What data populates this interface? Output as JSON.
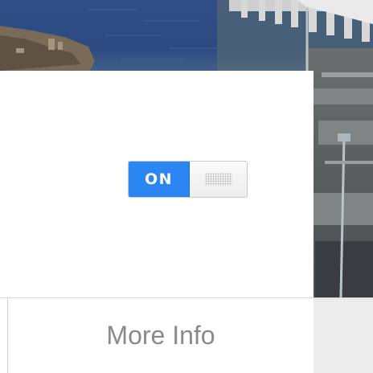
{
  "toggle": {
    "state_label": "ON",
    "is_on": true
  },
  "footer": {
    "more_info_label": "More Info"
  },
  "colors": {
    "toggle_on": "#2b86f4",
    "card_background": "#ffffff",
    "more_info_text": "#8a8a8a"
  }
}
